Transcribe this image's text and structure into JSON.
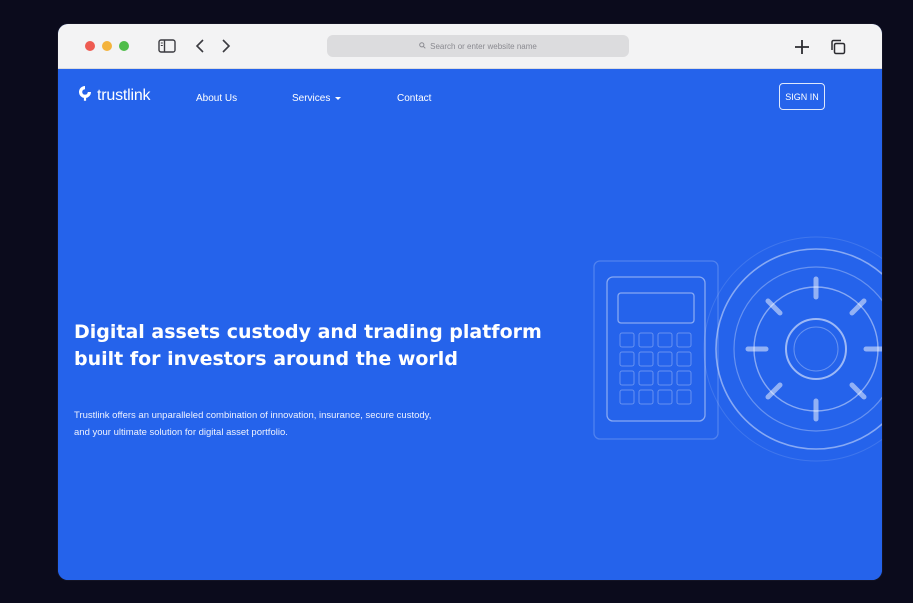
{
  "browser": {
    "address_placeholder": "Search or enter website name",
    "icons": [
      "sidebar-icon",
      "chevron-left-icon",
      "chevron-right-icon",
      "search-icon",
      "plus-icon",
      "tabs-icon"
    ]
  },
  "header": {
    "logo_text": "trustlink",
    "nav": {
      "about": "About Us",
      "services": "Services",
      "contact": "Contact"
    },
    "signin_label": "SIGN IN"
  },
  "hero": {
    "title_line1": "Digital assets custody and trading platform",
    "title_line2": "built for investors around the world",
    "subtitle_line1": "Trustlink offers an unparalleled combination of innovation, insurance, secure custody,",
    "subtitle_line2": "and your ultimate solution for digital asset portfolio."
  },
  "colors": {
    "brand_blue": "#2563eb",
    "backdrop": "#0b0b1c",
    "titlebar": "#f3f3f4"
  }
}
